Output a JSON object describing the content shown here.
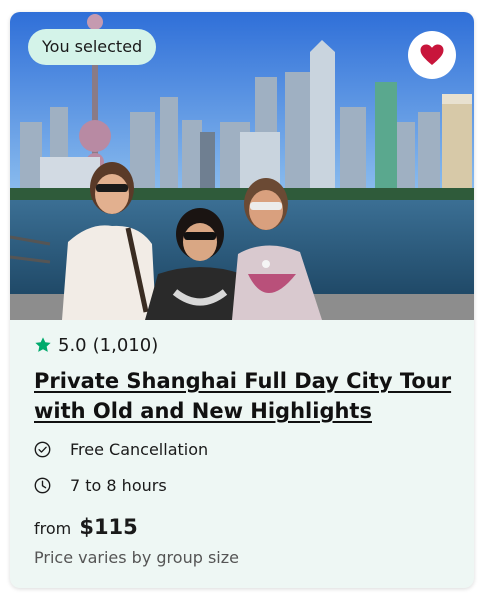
{
  "badge": {
    "label": "You selected"
  },
  "favorite": {
    "icon": "heart-icon",
    "color": "#c8153b",
    "active": true
  },
  "rating": {
    "icon": "star-icon",
    "color": "#00aa6c",
    "score": "5.0",
    "count": "(1,010)"
  },
  "tour": {
    "title_line1": "Private Shanghai Full Day City Tour",
    "title_line2": "with Old and New Highlights"
  },
  "features": [
    {
      "icon": "check-circle-icon",
      "label": "Free Cancellation"
    },
    {
      "icon": "clock-icon",
      "label": "7 to 8 hours"
    }
  ],
  "price": {
    "prefix": "from",
    "amount": "$115",
    "note": "Price varies by group size"
  }
}
